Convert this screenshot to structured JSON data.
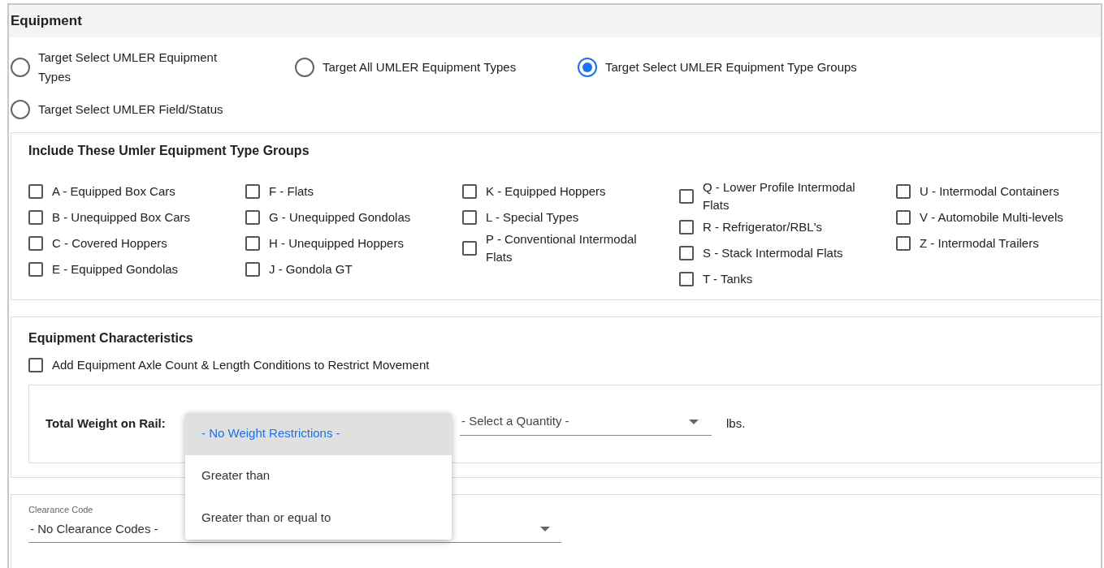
{
  "section": {
    "title": "Equipment"
  },
  "target_options": [
    {
      "label": "Target Select UMLER Equipment Types",
      "selected": false
    },
    {
      "label": "Target All UMLER Equipment Types",
      "selected": false
    },
    {
      "label": "Target Select UMLER Equipment Type Groups",
      "selected": true
    },
    {
      "label": "Target Select UMLER Field/Status",
      "selected": false
    }
  ],
  "type_groups": {
    "title": "Include These Umler Equipment Type Groups",
    "columns": [
      [
        {
          "label": "A - Equipped Box Cars",
          "checked": false
        },
        {
          "label": "B - Unequipped Box Cars",
          "checked": false
        },
        {
          "label": "C - Covered Hoppers",
          "checked": false
        },
        {
          "label": "E - Equipped Gondolas",
          "checked": false
        }
      ],
      [
        {
          "label": "F - Flats",
          "checked": false
        },
        {
          "label": "G - Unequipped Gondolas",
          "checked": false
        },
        {
          "label": "H - Unequipped Hoppers",
          "checked": false
        },
        {
          "label": "J - Gondola GT",
          "checked": false
        }
      ],
      [
        {
          "label": "K - Equipped Hoppers",
          "checked": false
        },
        {
          "label": "L - Special Types",
          "checked": false
        },
        {
          "label": "P - Conventional Intermodal Flats",
          "checked": false
        }
      ],
      [
        {
          "label": "Q - Lower Profile Intermodal Flats",
          "checked": false
        },
        {
          "label": "R - Refrigerator/RBL's",
          "checked": false
        },
        {
          "label": "S - Stack Intermodal Flats",
          "checked": false
        },
        {
          "label": "T - Tanks",
          "checked": false
        }
      ],
      [
        {
          "label": "U - Intermodal Containers",
          "checked": false
        },
        {
          "label": "V - Automobile Multi-levels",
          "checked": false
        },
        {
          "label": "Z - Intermodal Trailers",
          "checked": false
        }
      ]
    ]
  },
  "characteristics": {
    "title": "Equipment Characteristics",
    "axle_option": {
      "label": "Add Equipment Axle Count & Length Conditions to Restrict Movement",
      "checked": false
    },
    "weight": {
      "label": "Total Weight on Rail:",
      "menu": [
        {
          "label": "- No Weight Restrictions -",
          "selected": true
        },
        {
          "label": "Greater than",
          "selected": false
        },
        {
          "label": "Greater than or equal to",
          "selected": false
        }
      ],
      "quantity": {
        "value": "- Select a Quantity -"
      },
      "unit": "lbs."
    }
  },
  "clearance": {
    "label": "Clearance Code",
    "value": "- No Clearance Codes -"
  }
}
